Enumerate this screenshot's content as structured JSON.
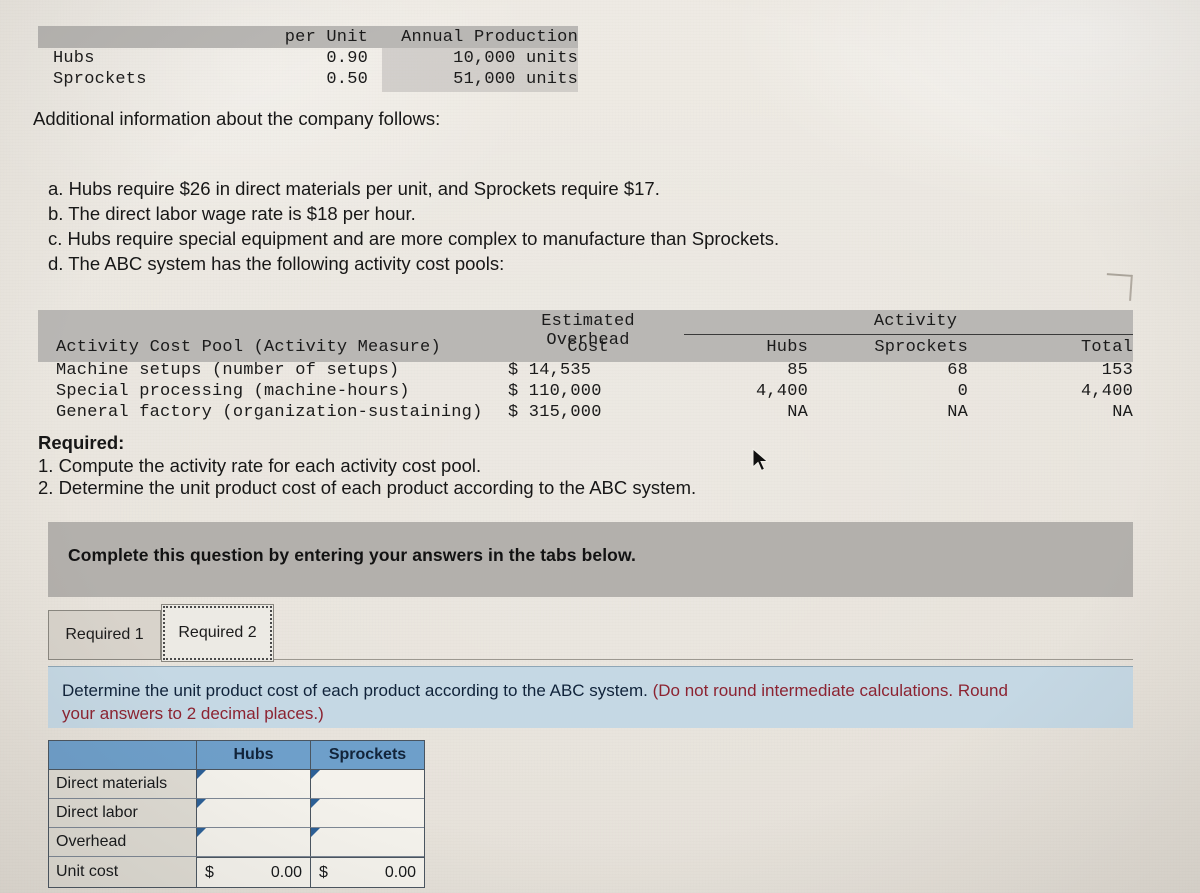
{
  "production_table": {
    "headers": [
      "",
      "per Unit",
      "Annual Production"
    ],
    "rows": [
      {
        "name": "Hubs",
        "per_unit": "0.90",
        "annual_production": "10,000 units"
      },
      {
        "name": "Sprockets",
        "per_unit": "0.50",
        "annual_production": "51,000 units"
      }
    ]
  },
  "intro": "Additional information about the company follows:",
  "bullets": [
    "a. Hubs require $26 in direct materials per unit, and Sprockets require $17.",
    "b. The direct labor wage rate is $18 per hour.",
    "c. Hubs require special equipment and are more complex to manufacture than Sprockets.",
    "d. The ABC system has the following activity cost pools:"
  ],
  "activity_table": {
    "group_header_cost": "Estimated Overhead",
    "group_header_activity": "Activity",
    "headers": {
      "pool": "Activity Cost Pool (Activity Measure)",
      "cost": "Cost",
      "hubs": "Hubs",
      "sprockets": "Sprockets",
      "total": "Total"
    },
    "rows": [
      {
        "pool": "Machine setups (number of setups)",
        "cost": "$  14,535",
        "hubs": "85",
        "sprockets": "68",
        "total": "153"
      },
      {
        "pool": "Special processing (machine-hours)",
        "cost": "$ 110,000",
        "hubs": "4,400",
        "sprockets": "0",
        "total": "4,400"
      },
      {
        "pool": "General factory (organization-sustaining)",
        "cost": "$ 315,000",
        "hubs": "NA",
        "sprockets": "NA",
        "total": "NA"
      }
    ]
  },
  "required": {
    "title": "Required:",
    "items": [
      "1. Compute the activity rate for each activity cost pool.",
      "2. Determine the unit product cost of each product according to the ABC system."
    ]
  },
  "grey_banner": {
    "text": "Complete this question by entering your answers in the tabs below."
  },
  "tabs": [
    {
      "label": "Required 1",
      "active": false
    },
    {
      "label": "Required 2",
      "active": true
    }
  ],
  "blue_banner": {
    "line1_dark": "Determine the unit product cost of each product according to the ABC system.",
    "line1_red": " (Do not round intermediate calculations. Round",
    "line2_red": "your answers to 2 decimal places.)"
  },
  "answer_grid": {
    "headers": {
      "blank": "",
      "hubs": "Hubs",
      "sprockets": "Sprockets"
    },
    "rows": [
      {
        "label": "Direct materials",
        "hubs": "",
        "sprockets": ""
      },
      {
        "label": "Direct labor",
        "hubs": "",
        "sprockets": ""
      },
      {
        "label": "Overhead",
        "hubs": "",
        "sprockets": ""
      }
    ],
    "total_row": {
      "label": "Unit cost",
      "hubs_currency": "$",
      "hubs_value": "0.00",
      "sprockets_currency": "$",
      "sprockets_value": "0.00"
    }
  },
  "colors": {
    "paper": "#e9e5de",
    "mono_band": "#b9b7b4",
    "grey_banner": "#b3b0ac",
    "blue_banner": "#c5d8e4",
    "grid_header_blue": "#6e9fca",
    "red_text": "#8c2331",
    "dark_text": "#10233a"
  }
}
